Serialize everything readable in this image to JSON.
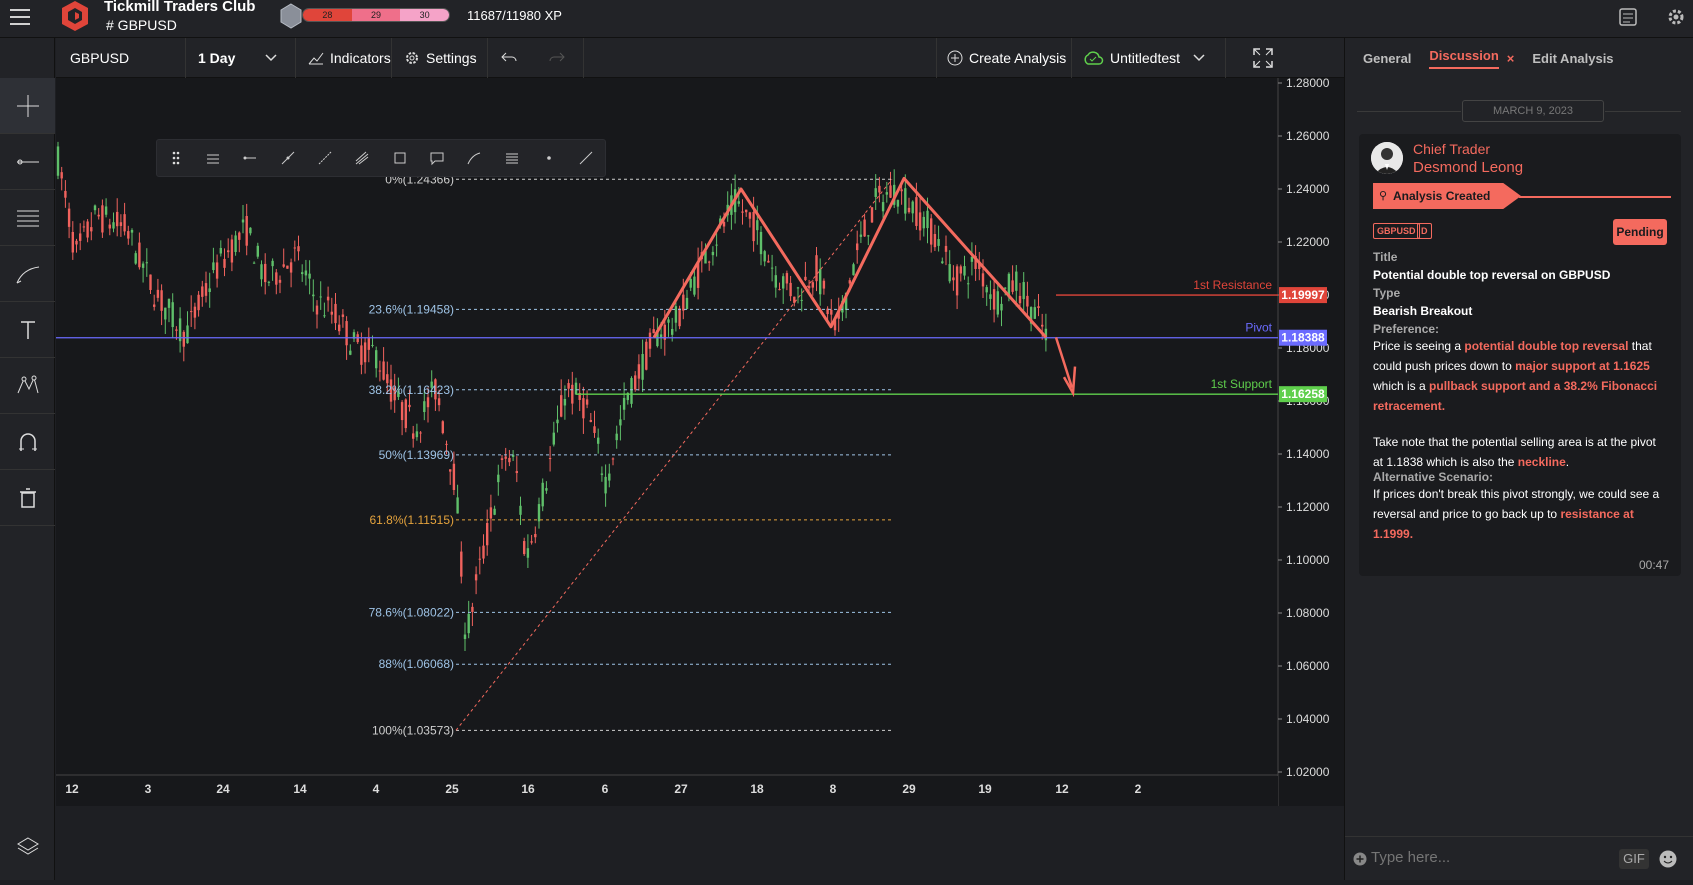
{
  "topbar": {
    "club_name": "Tickmill Traders Club",
    "channel": "# GBPUSD",
    "xp_segments": [
      "28",
      "29",
      "30"
    ],
    "xp_text": "11687/11980 XP"
  },
  "toolbar": {
    "symbol": "GBPUSD",
    "interval": "1 Day",
    "indicators_label": "Indicators",
    "settings_label": "Settings",
    "create_analysis_label": "Create Analysis",
    "analysis_name": "Untitledtest"
  },
  "chart_data": {
    "type": "candlestick",
    "symbol": "GBPUSD",
    "y_ticks": [
      "1.28000",
      "1.26000",
      "1.24000",
      "1.22000",
      "1.20000",
      "1.18000",
      "1.16000",
      "1.14000",
      "1.12000",
      "1.10000",
      "1.08000",
      "1.06000",
      "1.04000",
      "1.02000"
    ],
    "x_ticks": [
      "12",
      "3",
      "24",
      "14",
      "4",
      "25",
      "16",
      "6",
      "27",
      "18",
      "8",
      "29",
      "19",
      "12",
      "2"
    ],
    "fib_levels": [
      {
        "label": "0%(1.24366)",
        "price": 1.24366,
        "color": "#cfcfcf"
      },
      {
        "label": "23.6%(1.19458)",
        "price": 1.19458,
        "color": "#9ec3e6"
      },
      {
        "label": "38.2%(1.16423)",
        "price": 1.16423,
        "color": "#9ec3e6"
      },
      {
        "label": "50%(1.13969)",
        "price": 1.13969,
        "color": "#9ec3e6"
      },
      {
        "label": "61.8%(1.11515)",
        "price": 1.11515,
        "color": "#e5a33d"
      },
      {
        "label": "78.6%(1.08022)",
        "price": 1.08022,
        "color": "#9ec3e6"
      },
      {
        "label": "88%(1.06068)",
        "price": 1.06068,
        "color": "#9ec3e6"
      },
      {
        "label": "100%(1.03573)",
        "price": 1.03573,
        "color": "#cfcfcf"
      }
    ],
    "lines": [
      {
        "name": "1st Resistance",
        "price": 1.19997,
        "price_label": "1.19997",
        "color": "#e0453a"
      },
      {
        "name": "Pivot",
        "price": 1.18388,
        "price_label": "1.18388",
        "color": "#6b6bff"
      },
      {
        "name": "1st Support",
        "price": 1.16258,
        "price_label": "1.16258",
        "color": "#5fcf4c"
      }
    ],
    "ylim": [
      1.0,
      1.29
    ]
  },
  "panel": {
    "tabs": [
      "General",
      "Discussion",
      "Edit Analysis"
    ],
    "date": "MARCH 9, 2023",
    "role": "Chief Trader",
    "author": "Desmond Leong",
    "event": "Analysis Created",
    "tags": [
      "GBPUSD",
      "D"
    ],
    "status": "Pending",
    "title_label": "Title",
    "title_value": "Potential double top reversal on GBPUSD",
    "type_label": "Type",
    "type_value": "Bearish Breakout",
    "preference_label": "Preference:",
    "pref_1": "Price is seeing a ",
    "pref_2": "potential double top reversal",
    "pref_3": " that could push prices down to ",
    "pref_4": "major support at 1.1625",
    "pref_5": " which is a ",
    "pref_6": "pullback support and a 38.2% Fibonacci retracement.",
    "note_1": "Take note that the potential selling area is at the pivot at 1.1838 which is also the ",
    "note_2": "neckline",
    "note_3": ".",
    "alt_label": "Alternative Scenario:",
    "alt_1": "If prices don't break this pivot strongly, we could see a reversal and price to go back up to ",
    "alt_2": "resistance at 1.1999.",
    "time": "00:47",
    "composer_placeholder": "Type here...",
    "gif_label": "GIF"
  }
}
